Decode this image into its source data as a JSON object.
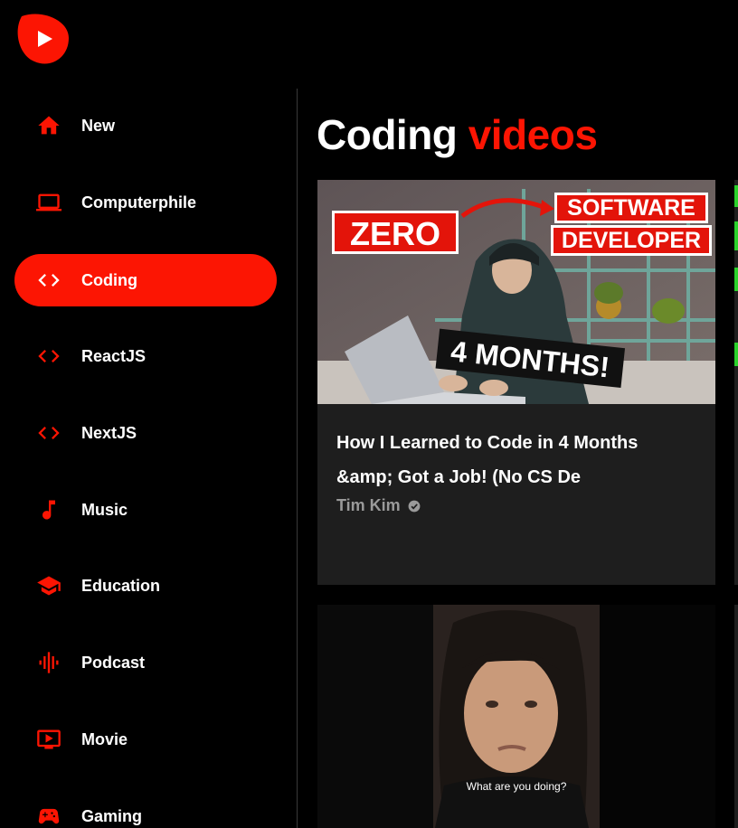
{
  "app": {
    "logo_icon": "logo-icon"
  },
  "sidebar": {
    "items": [
      {
        "label": "New",
        "icon": "home-icon",
        "active": false
      },
      {
        "label": "Computerphile",
        "icon": "laptop-icon",
        "active": false
      },
      {
        "label": "Coding",
        "icon": "code-icon",
        "active": true
      },
      {
        "label": "ReactJS",
        "icon": "code-icon",
        "active": false
      },
      {
        "label": "NextJS",
        "icon": "code-icon",
        "active": false
      },
      {
        "label": "Music",
        "icon": "music-note-icon",
        "active": false
      },
      {
        "label": "Education",
        "icon": "school-icon",
        "active": false
      },
      {
        "label": "Podcast",
        "icon": "graphic-eq-icon",
        "active": false
      },
      {
        "label": "Movie",
        "icon": "ondemand-video-icon",
        "active": false
      },
      {
        "label": "Gaming",
        "icon": "gamepad-icon",
        "active": false
      }
    ]
  },
  "main": {
    "heading_prefix": "Coding",
    "heading_accent": "videos",
    "videos": [
      {
        "title_line1": "How I Learned to Code in 4 Months",
        "title_line2": "&amp; Got a Job! (No CS De",
        "channel": "Tim Kim",
        "thumb_text": {
          "zero": "ZERO",
          "software": "SOFTWARE",
          "developer": "DEVELOPER",
          "months": "4 MONTHS!"
        }
      },
      {
        "caption": "What are you doing?"
      }
    ]
  },
  "colors": {
    "accent": "#fc1503",
    "background": "#000000",
    "card": "#1e1e1e",
    "muted": "#9a9a9a"
  }
}
